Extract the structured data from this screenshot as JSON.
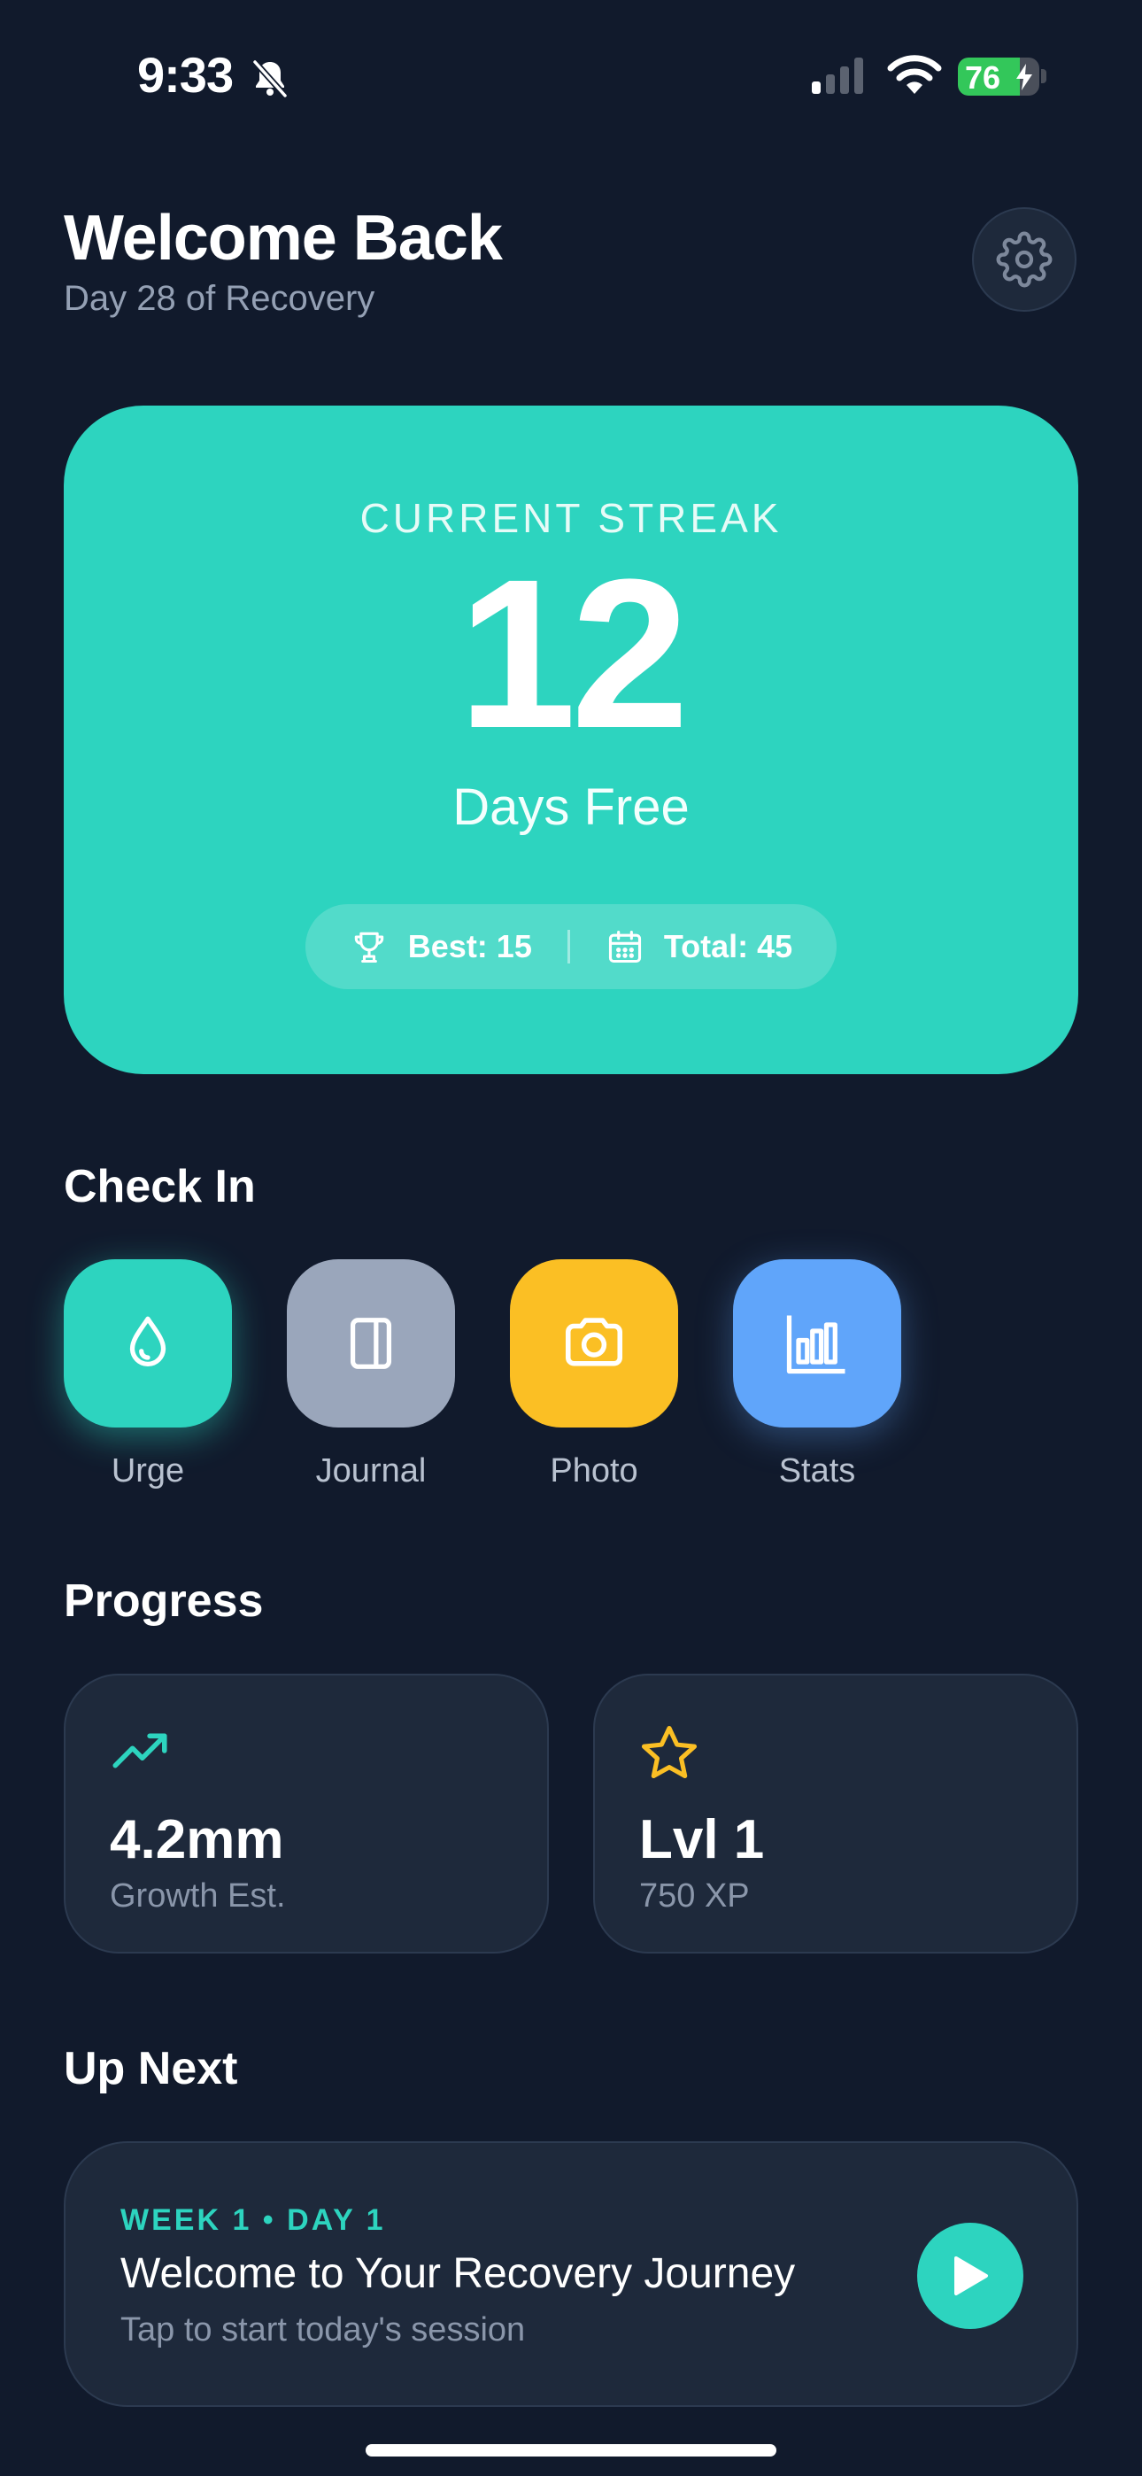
{
  "status_bar": {
    "time": "9:33",
    "battery_percent": "76",
    "battery_level": 0.76,
    "icons": [
      "bell-slash-icon",
      "signal-icon",
      "wifi-icon",
      "battery-icon"
    ]
  },
  "header": {
    "title": "Welcome Back",
    "subtitle": "Day 28 of Recovery",
    "settings_icon": "gear-icon"
  },
  "streak": {
    "label": "CURRENT STREAK",
    "value": "12",
    "unit": "Days Free",
    "best": "Best: 15",
    "total": "Total: 45",
    "best_icon": "trophy-icon",
    "total_icon": "calendar-icon",
    "color": "#2dd4bf"
  },
  "check_in": {
    "title": "Check In",
    "items": [
      {
        "label": "Urge",
        "icon": "droplet-icon",
        "color": "#2dd4bf"
      },
      {
        "label": "Journal",
        "icon": "journal-icon",
        "color": "#9aa6bb"
      },
      {
        "label": "Photo",
        "icon": "camera-icon",
        "color": "#fbbf24"
      },
      {
        "label": "Stats",
        "icon": "bar-chart-icon",
        "color": "#60a5fa"
      }
    ]
  },
  "progress": {
    "title": "Progress",
    "cards": [
      {
        "value": "4.2mm",
        "label": "Growth Est.",
        "icon": "trending-up-icon",
        "color": "#2dd4bf"
      },
      {
        "value": "Lvl 1",
        "label": "750 XP",
        "icon": "star-icon",
        "color": "#fbbf24"
      }
    ]
  },
  "up_next": {
    "title": "Up Next",
    "tag": "WEEK 1 • DAY 1",
    "session_title": "Welcome to Your Recovery Journey",
    "session_sub": "Tap to start today's session",
    "play_icon": "play-icon"
  },
  "colors": {
    "background": "#111a2c",
    "card": "#1e293b",
    "accent": "#2dd4bf"
  }
}
